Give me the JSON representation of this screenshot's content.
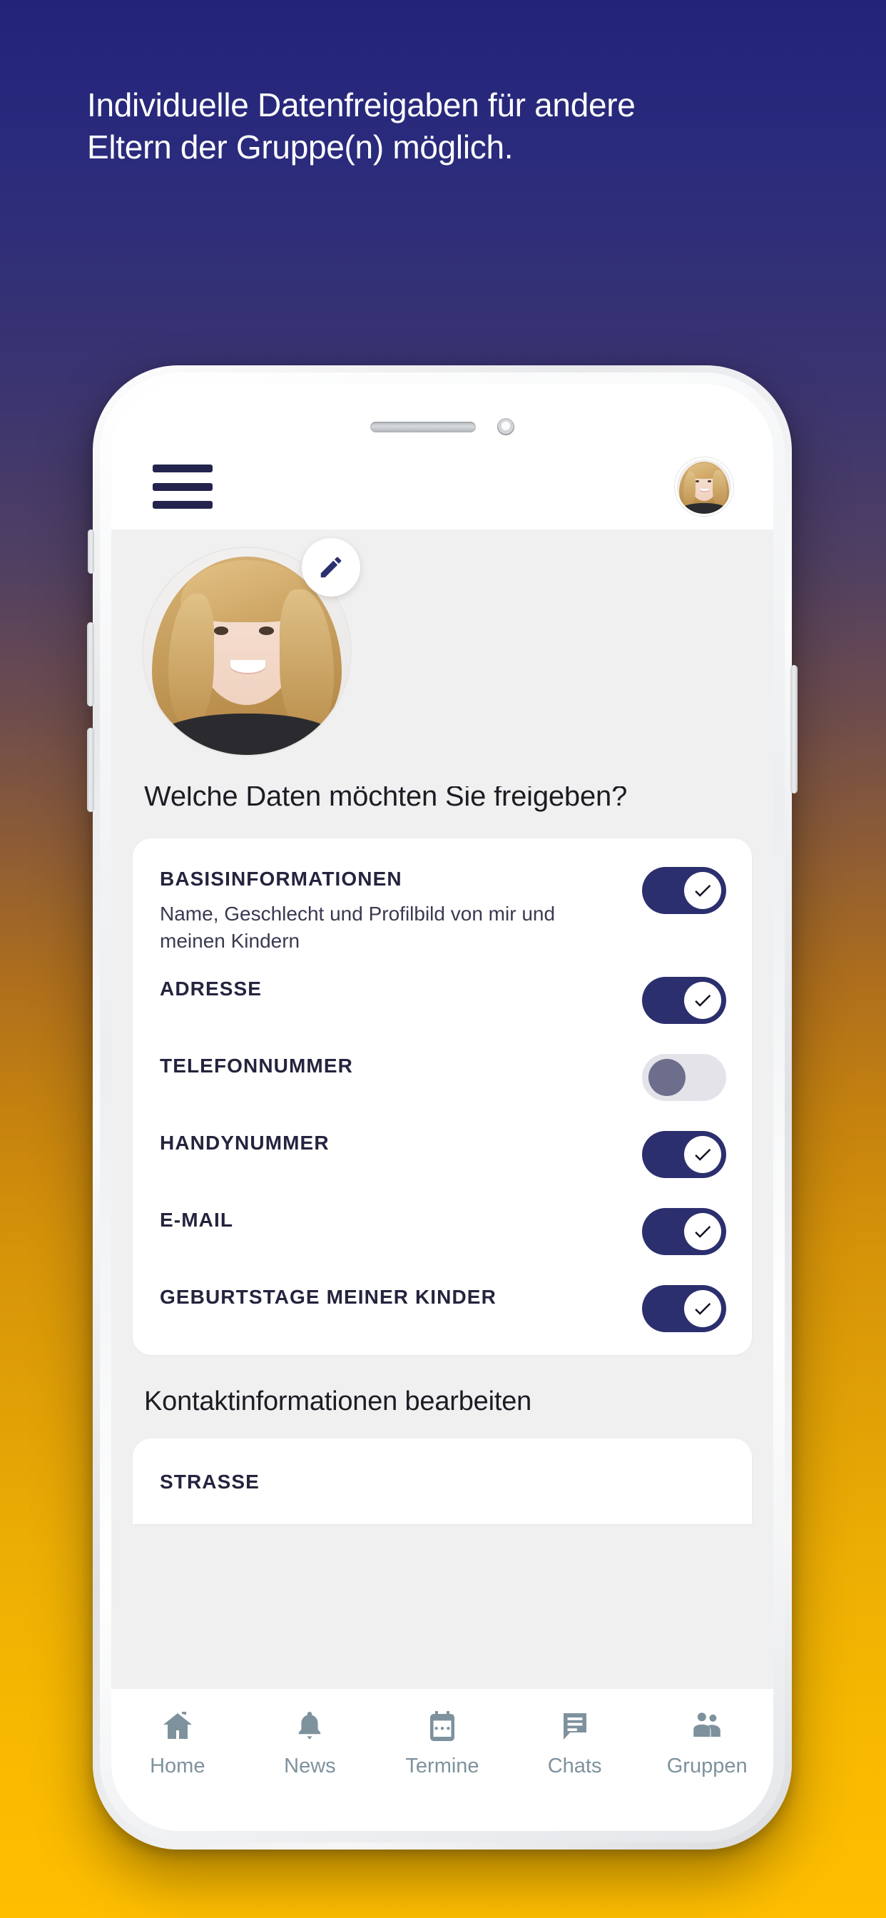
{
  "promo": {
    "headline_line1": "Individuelle Datenfreigaben für andere",
    "headline_line2": "Eltern der Gruppe(n) möglich."
  },
  "colors": {
    "brand_navy": "#2c2f6e",
    "headline_text": "#ffffff",
    "bg_top": "#23237a",
    "bg_bottom": "#ffbe00",
    "toggle_on_track": "#2c2f6e",
    "toggle_off_track": "#e3e3e9",
    "toggle_off_knob": "#6d6d8c",
    "nav_icon": "#7e929d",
    "screen_bg": "#f0f0f0",
    "card_bg": "#ffffff"
  },
  "header": {
    "menu_icon": "hamburger-menu-icon",
    "avatar_icon": "user-avatar"
  },
  "profile": {
    "photo_icon": "profile-photo",
    "edit_icon": "pencil-edit-icon"
  },
  "main": {
    "section_title": "Welche Daten möchten Sie freigeben?",
    "subsection_title": "Kontaktinformationen bearbeiten",
    "permissions": [
      {
        "title": "BASISINFORMATIONEN",
        "subtitle": "Name, Geschlecht und Profilbild von mir und meinen Kindern",
        "enabled": true
      },
      {
        "title": "ADRESSE",
        "subtitle": "",
        "enabled": true
      },
      {
        "title": "TELEFONNUMMER",
        "subtitle": "",
        "enabled": false
      },
      {
        "title": "HANDYNUMMER",
        "subtitle": "",
        "enabled": true
      },
      {
        "title": "E-MAIL",
        "subtitle": "",
        "enabled": true
      },
      {
        "title": "GEBURTSTAGE MEINER KINDER",
        "subtitle": "",
        "enabled": true
      }
    ],
    "contact_fields": [
      {
        "title": "STRASSE",
        "value": ""
      }
    ]
  },
  "bottom_nav": {
    "items": [
      {
        "label": "Home",
        "icon": "home-icon"
      },
      {
        "label": "News",
        "icon": "bell-icon"
      },
      {
        "label": "Termine",
        "icon": "calendar-icon"
      },
      {
        "label": "Chats",
        "icon": "chat-bubble-icon"
      },
      {
        "label": "Gruppen",
        "icon": "group-people-icon"
      }
    ]
  },
  "device": {
    "speaker_icon": "speaker-grille",
    "camera_icon": "front-camera"
  }
}
